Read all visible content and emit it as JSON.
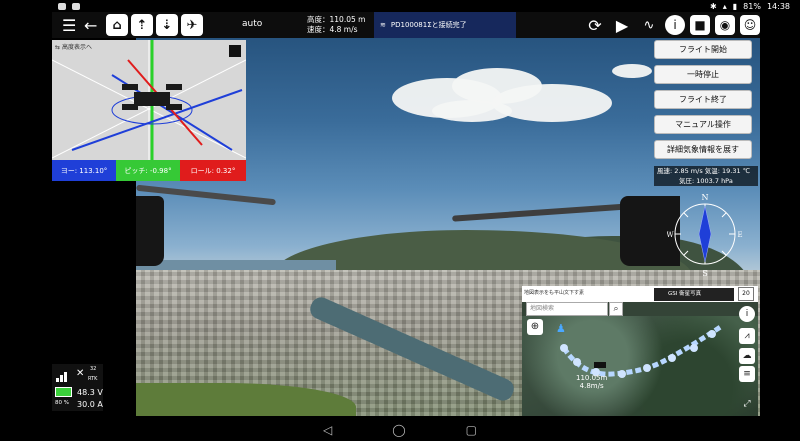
{
  "statusbar": {
    "battery": "81%",
    "time": "14:38"
  },
  "toolbar": {
    "mode": "auto",
    "altitude": "高度：110.05 m",
    "speed": "速度：4.8 m/s",
    "connection": "PD100081Σと接続完了"
  },
  "attitude": {
    "toggle_label": "高度表示へ",
    "yaw": "ヨー: 113.10°",
    "pitch": "ピッチ: -0.98°",
    "roll": "ロール: 0.32°"
  },
  "buttons": {
    "start_flight": "フライト開始",
    "pause": "一時停止",
    "end_flight": "フライト終了",
    "manual": "マニュアル操作",
    "weather_detail": "詳細気象情報を展す"
  },
  "weather": {
    "wind": "風速: 2.85 m/s",
    "temperature": "気温: 19.31 ℃",
    "pressure": "気圧: 1003.7 hPa"
  },
  "compass": {
    "n": "N",
    "e": "E",
    "s": "S",
    "w": "W"
  },
  "telemetry": {
    "satellites": "32",
    "rtk": "RTK",
    "percent": "80 %",
    "voltage": "48.3 V",
    "current": "30.0 A"
  },
  "map": {
    "note": "地図表示をも平山文下す素",
    "layer": "GSI 衛星写真",
    "zoom": "20",
    "search_placeholder": "地図検索",
    "altitude_label": "110.05m",
    "speed_label": "4.8m/s"
  },
  "colors": {
    "yaw": "#1f3fd8",
    "pitch": "#36c936",
    "roll": "#e01c1c",
    "connection": "#16285c"
  }
}
